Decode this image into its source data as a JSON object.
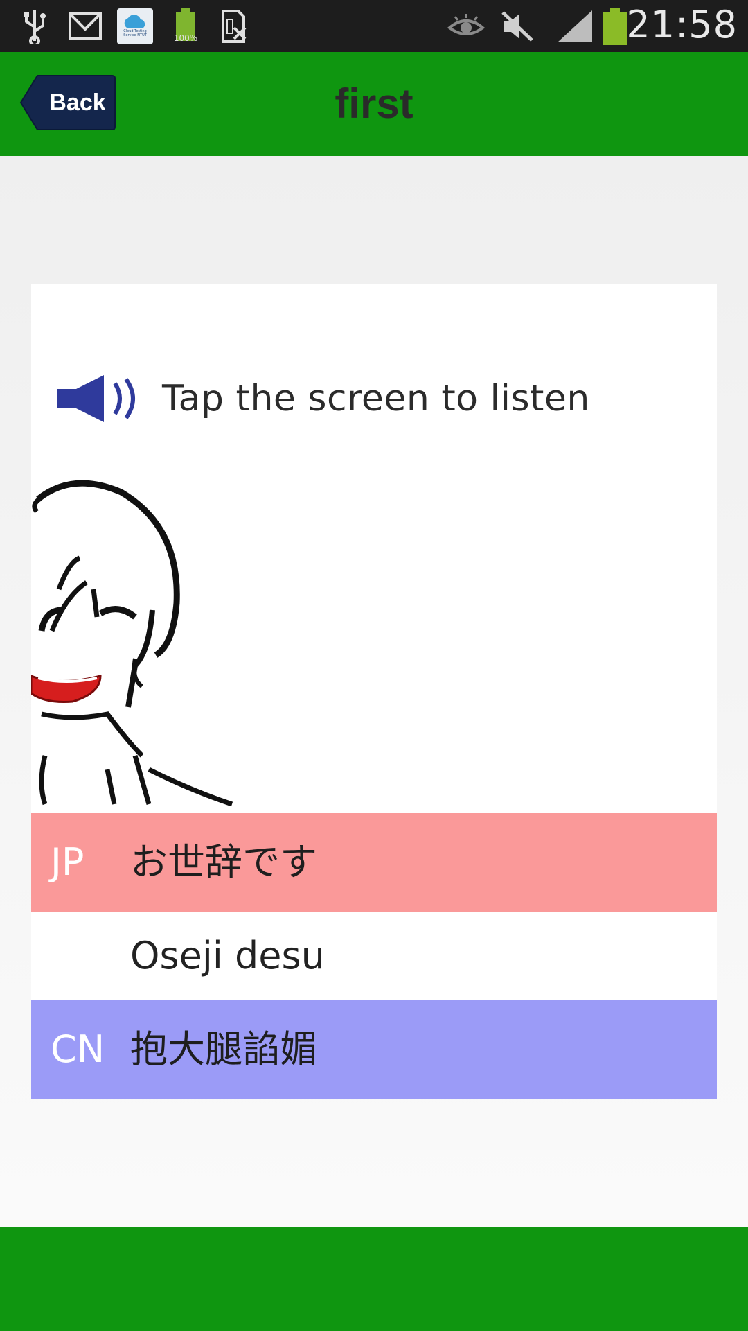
{
  "status_bar": {
    "time": "21:58",
    "battery_app_label": "100%",
    "cloud_app_label": "Cloud Testing Service NTUT",
    "icons": [
      "usb-icon",
      "gmail-icon",
      "cloud-testing-app-icon",
      "battery-app-icon",
      "sim-off-icon",
      "eye-icon",
      "mute-icon",
      "signal-icon",
      "battery-icon"
    ]
  },
  "header": {
    "back_label": "Back",
    "title": "first"
  },
  "card": {
    "hint": "Tap the screen to listen",
    "jp_code": "JP",
    "jp_text": "お世辞です",
    "romaji": "Oseji desu",
    "cn_code": "CN",
    "cn_text": "抱大腿諂媚"
  },
  "colors": {
    "app_bar": "#0f9610",
    "back_button": "#14264c",
    "jp_row": "#fa9999",
    "cn_row": "#9b9bf7",
    "speaker": "#2f3a9c"
  }
}
